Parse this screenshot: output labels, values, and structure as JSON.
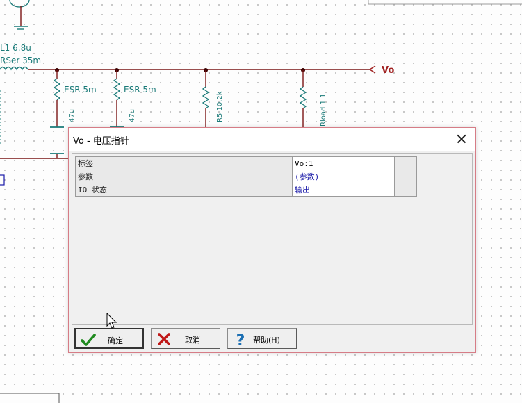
{
  "schematic": {
    "inductor_name": "L1 6.8u",
    "inductor_rser": "RSer 35m",
    "esr1": "ESR 5m",
    "esr2": "ESR 5m",
    "cap1_value": "47u",
    "cap2_value": "47u",
    "r5_label": "R5 10.2k",
    "rload_label": "Rload 1.1",
    "net_label": "Vo"
  },
  "dialog": {
    "title": "Vo - 电压指针",
    "close_label": "close",
    "properties": [
      {
        "key": "标签",
        "value": "Vo:1"
      },
      {
        "key": "参数",
        "value": "(参数)"
      },
      {
        "key": "IO 状态",
        "value": "输出"
      }
    ],
    "buttons": {
      "ok": "确定",
      "cancel": "取消",
      "help": "帮助(H)"
    }
  },
  "colors": {
    "wire": "#7a1515",
    "component": "#1a7a78",
    "dialog_border": "#d67c86",
    "value_text": "#1a1aa8"
  },
  "icons": [
    "check-icon",
    "x-icon",
    "question-icon",
    "close-icon",
    "mouse-cursor-icon"
  ]
}
